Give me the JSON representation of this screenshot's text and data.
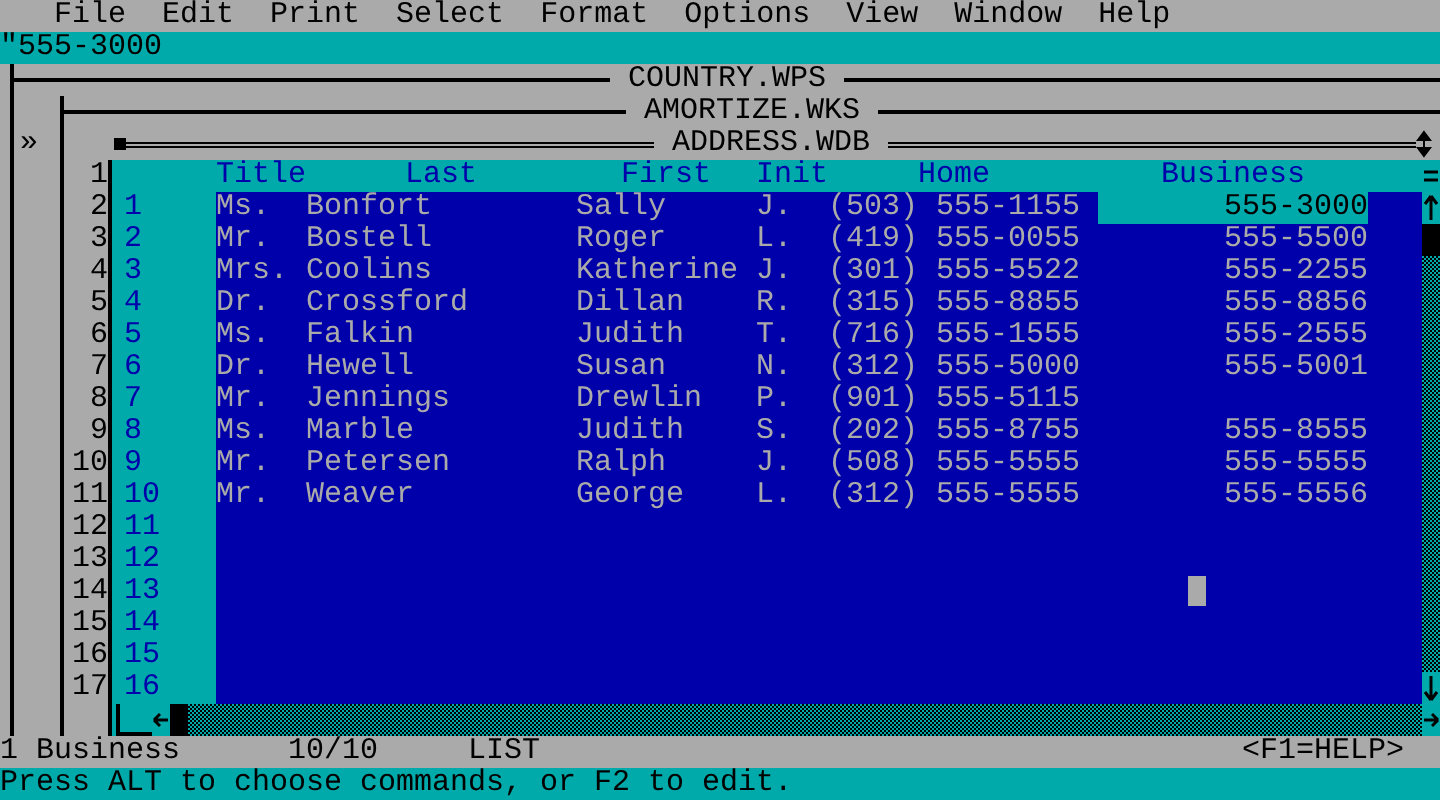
{
  "menu": [
    {
      "label": "File"
    },
    {
      "label": "Edit"
    },
    {
      "label": "Print"
    },
    {
      "label": "Select"
    },
    {
      "label": "Format"
    },
    {
      "label": "Options"
    },
    {
      "label": "View"
    },
    {
      "label": "Window"
    },
    {
      "label": "Help"
    }
  ],
  "entry_line": {
    "value": "\"555-3000"
  },
  "back_windows": [
    {
      "title": "COUNTRY.WPS"
    },
    {
      "title": "AMORTIZE.WKS"
    }
  ],
  "window_marker": "»",
  "sheet_row_numbers": [
    "1",
    "2",
    "3",
    "4",
    "5",
    "6",
    "7",
    "8",
    "9",
    "10",
    "11",
    "12",
    "13",
    "14",
    "15",
    "16",
    "17"
  ],
  "database": {
    "title": "ADDRESS.WDB",
    "columns": [
      {
        "label": "Title"
      },
      {
        "label": "Last"
      },
      {
        "label": "First"
      },
      {
        "label": "Init"
      },
      {
        "label": "Home"
      },
      {
        "label": "Business"
      }
    ],
    "records": [
      {
        "number": "1",
        "cells": [
          {
            "text": "Ms.",
            "selected": false
          },
          {
            "text": "Bonfort",
            "selected": false
          },
          {
            "text": "Sally",
            "selected": false
          },
          {
            "text": "J.",
            "selected": false
          },
          {
            "text": "(503) 555-1155",
            "selected": false
          },
          {
            "text": "555-3000",
            "selected": true
          }
        ]
      },
      {
        "number": "2",
        "cells": [
          {
            "text": "Mr.",
            "selected": false
          },
          {
            "text": "Bostell",
            "selected": false
          },
          {
            "text": "Roger",
            "selected": false
          },
          {
            "text": "L.",
            "selected": false
          },
          {
            "text": "(419) 555-0055",
            "selected": false
          },
          {
            "text": "555-5500",
            "selected": false
          }
        ]
      },
      {
        "number": "3",
        "cells": [
          {
            "text": "Mrs.",
            "selected": false
          },
          {
            "text": "Coolins",
            "selected": false
          },
          {
            "text": "Katherine",
            "selected": false
          },
          {
            "text": "J.",
            "selected": false
          },
          {
            "text": "(301) 555-5522",
            "selected": false
          },
          {
            "text": "555-2255",
            "selected": false
          }
        ]
      },
      {
        "number": "4",
        "cells": [
          {
            "text": "Dr.",
            "selected": false
          },
          {
            "text": "Crossford",
            "selected": false
          },
          {
            "text": "Dillan",
            "selected": false
          },
          {
            "text": "R.",
            "selected": false
          },
          {
            "text": "(315) 555-8855",
            "selected": false
          },
          {
            "text": "555-8856",
            "selected": false
          }
        ]
      },
      {
        "number": "5",
        "cells": [
          {
            "text": "Ms.",
            "selected": false
          },
          {
            "text": "Falkin",
            "selected": false
          },
          {
            "text": "Judith",
            "selected": false
          },
          {
            "text": "T.",
            "selected": false
          },
          {
            "text": "(716) 555-1555",
            "selected": false
          },
          {
            "text": "555-2555",
            "selected": false
          }
        ]
      },
      {
        "number": "6",
        "cells": [
          {
            "text": "Dr.",
            "selected": false
          },
          {
            "text": "Hewell",
            "selected": false
          },
          {
            "text": "Susan",
            "selected": false
          },
          {
            "text": "N.",
            "selected": false
          },
          {
            "text": "(312) 555-5000",
            "selected": false
          },
          {
            "text": "555-5001",
            "selected": false
          }
        ]
      },
      {
        "number": "7",
        "cells": [
          {
            "text": "Mr.",
            "selected": false
          },
          {
            "text": "Jennings",
            "selected": false
          },
          {
            "text": "Drewlin",
            "selected": false
          },
          {
            "text": "P.",
            "selected": false
          },
          {
            "text": "(901) 555-5115",
            "selected": false
          },
          {
            "selected": false
          }
        ]
      },
      {
        "number": "8",
        "cells": [
          {
            "text": "Ms.",
            "selected": false
          },
          {
            "text": "Marble",
            "selected": false
          },
          {
            "text": "Judith",
            "selected": false
          },
          {
            "text": "S.",
            "selected": false
          },
          {
            "text": "(202) 555-8755",
            "selected": false
          },
          {
            "text": "555-8555",
            "selected": false
          }
        ]
      },
      {
        "number": "9",
        "cells": [
          {
            "text": "Mr.",
            "selected": false
          },
          {
            "text": "Petersen",
            "selected": false
          },
          {
            "text": "Ralph",
            "selected": false
          },
          {
            "text": "J.",
            "selected": false
          },
          {
            "text": "(508) 555-5555",
            "selected": false
          },
          {
            "text": "555-5555",
            "selected": false
          }
        ]
      },
      {
        "number": "10",
        "cells": [
          {
            "text": "Mr.",
            "selected": false
          },
          {
            "text": "Weaver",
            "selected": false
          },
          {
            "text": "George",
            "selected": false
          },
          {
            "text": "L.",
            "selected": false
          },
          {
            "text": "(312) 555-5555",
            "selected": false
          },
          {
            "text": "555-5556",
            "selected": false
          }
        ]
      },
      {
        "number": "11"
      },
      {
        "number": "12"
      },
      {
        "number": "13"
      },
      {
        "number": "14"
      },
      {
        "number": "15"
      },
      {
        "number": "16"
      }
    ]
  },
  "status_bar": {
    "field": "1 Business",
    "count": "10/10",
    "view": "LIST",
    "help": "<F1=HELP>"
  },
  "message": "Press ALT to choose commands, or F2 to edit."
}
